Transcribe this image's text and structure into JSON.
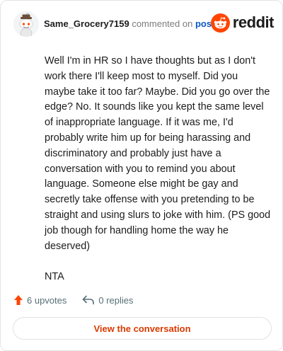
{
  "header": {
    "username": "Same_Grocery7159",
    "commented_text": "commented on",
    "post_link": "post",
    "logo_text": "reddit",
    "logo_icon": "reddit-snoo-icon"
  },
  "comment": {
    "paragraphs": [
      "Well I'm in HR so I have thoughts but as I don't work there I'll keep most to myself. Did you maybe take it too far? Maybe. Did you go over the edge? No. It sounds like you kept the same level of inappropriate language. If it was me, I'd probably write him up for being harassing and discriminatory and probably just have a conversation with you to remind you about language. Someone else might be gay and secretly take offense with you pretending to be straight and using slurs to joke with him. (PS good job though for handling home the way he deserved)",
      "NTA"
    ]
  },
  "actions": {
    "upvotes_label": "6 upvotes",
    "replies_label": "0 replies",
    "upvote_icon": "upvote-arrow-icon",
    "reply_icon": "reply-arrow-icon"
  },
  "cta": {
    "label": "View the conversation"
  },
  "colors": {
    "accent": "#d93a00",
    "upvote": "#ff4500",
    "link": "#0a58ca",
    "muted": "#576f76"
  }
}
